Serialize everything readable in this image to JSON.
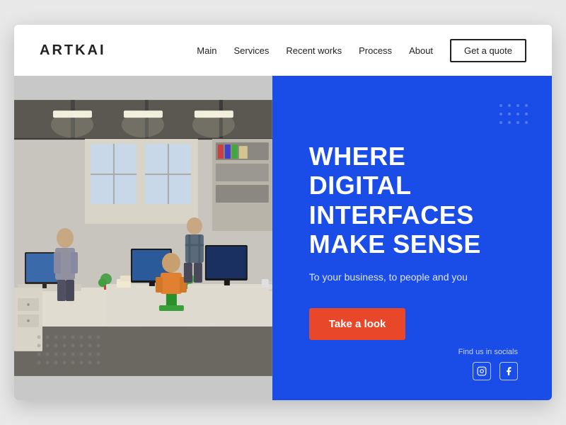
{
  "logo": {
    "text": "ARTKAI"
  },
  "nav": {
    "links": [
      {
        "label": "Main",
        "id": "main"
      },
      {
        "label": "Services",
        "id": "services"
      },
      {
        "label": "Recent works",
        "id": "recent-works"
      },
      {
        "label": "Process",
        "id": "process"
      },
      {
        "label": "About",
        "id": "about"
      }
    ],
    "cta_label": "Get a quote"
  },
  "hero": {
    "headline_line1": "WHERE",
    "headline_line2": "DIGITAL INTERFACES",
    "headline_line3": "MAKE SENSE",
    "subtitle": "To your business, to people and you",
    "cta_label": "Take a look"
  },
  "social": {
    "find_us_text": "Find us in socials",
    "instagram_icon": "instagram",
    "facebook_icon": "facebook"
  }
}
